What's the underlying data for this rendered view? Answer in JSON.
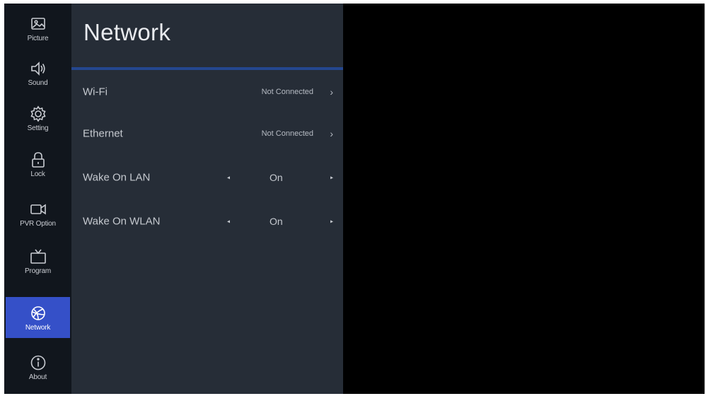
{
  "sidebar": {
    "items": [
      {
        "label": "Picture",
        "icon": "picture-icon"
      },
      {
        "label": "Sound",
        "icon": "speaker-icon"
      },
      {
        "label": "Setting",
        "icon": "gear-icon"
      },
      {
        "label": "Lock",
        "icon": "lock-icon"
      },
      {
        "label": "PVR Option",
        "icon": "video-camera-icon"
      },
      {
        "label": "Program",
        "icon": "tv-icon"
      },
      {
        "label": "Network",
        "icon": "globe-icon",
        "active": true
      },
      {
        "label": "About",
        "icon": "info-icon"
      }
    ]
  },
  "panel": {
    "title": "Network",
    "rows": [
      {
        "label": "Wi-Fi",
        "status": "Not Connected",
        "chevron": "›"
      },
      {
        "label": "Ethernet",
        "status": "Not Connected",
        "chevron": "›"
      },
      {
        "label": "Wake On LAN",
        "value": "On",
        "left_arrow": "◂",
        "right_arrow": "▸"
      },
      {
        "label": "Wake On WLAN",
        "value": "On",
        "left_arrow": "◂",
        "right_arrow": "▸"
      }
    ]
  },
  "colors": {
    "sidebar_bg": "#11161d",
    "panel_bg": "#262d37",
    "accent": "#3550c8",
    "divider": "#24478f",
    "screen_bg": "#000000"
  }
}
